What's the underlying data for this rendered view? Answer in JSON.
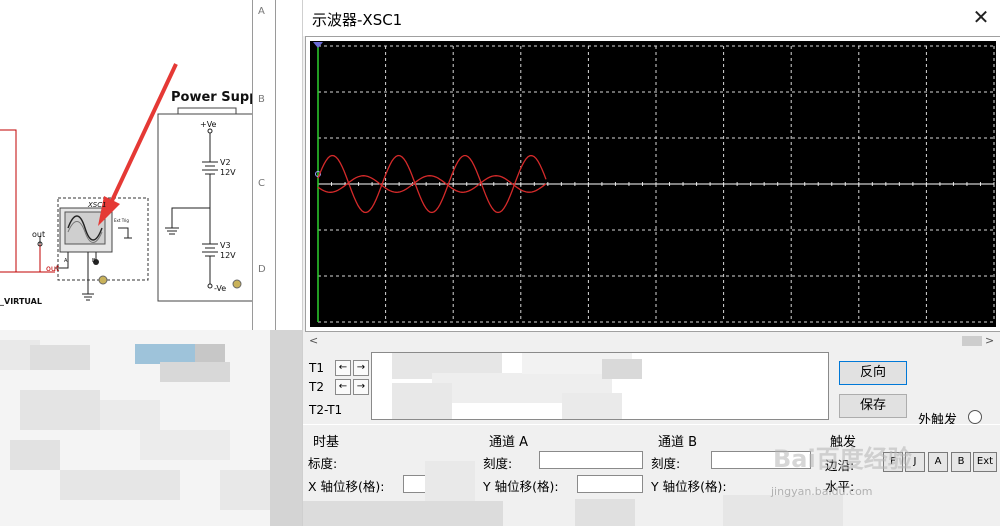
{
  "schematic": {
    "border_letters": [
      "A",
      "B",
      "C",
      "D"
    ],
    "power_supply_title": "Power Supply",
    "vpos_label": "+Ve",
    "vneg_label": "-Ve",
    "v2_name": "V2",
    "v2_value": "12V",
    "v3_name": "V3",
    "v3_value": "12V",
    "scope_ref": "XSC1",
    "scope_ext_trig": "Ext Trig",
    "scope_pin_a": "A",
    "scope_pin_b": "B",
    "out_label": "out",
    "out_label_red": "out",
    "virtual_label": "_VIRTUAL",
    "colors": {
      "wire_red": "#c00000",
      "wire_dark": "#222222",
      "arrow_red": "#e53935"
    }
  },
  "oscilloscope": {
    "title": "示波器-XSC1",
    "close_icon": "close-icon",
    "scrollbar_left": "<",
    "scrollbar_right": ">",
    "cursor_rows": [
      {
        "label": "T1",
        "left": "←",
        "right": "→"
      },
      {
        "label": "T2",
        "left": "←",
        "right": "→"
      },
      {
        "label": "T2-T1"
      }
    ],
    "buttons": {
      "reverse": "反向",
      "save": "保存"
    },
    "ext_trigger_label": "外触发",
    "timebase": {
      "title": "时基",
      "scale_label": "标度:",
      "xpos_label": "X 轴位移(格):"
    },
    "channel_a": {
      "title": "通道 A",
      "scale_label": "刻度:",
      "ypos_label": "Y 轴位移(格):"
    },
    "channel_b": {
      "title": "通道 B",
      "scale_label": "刻度:",
      "ypos_label": "Y 轴位移(格):"
    },
    "trigger": {
      "title": "触发",
      "edge_label": "边沿:",
      "level_label": "水平:",
      "edge_buttons": [
        "F",
        "J",
        "A",
        "B",
        "Ext"
      ]
    },
    "watermark_text": "Bai百度经验",
    "watermark_url": "jingyan.baidu.com",
    "colors": {
      "screen_bg": "#000000",
      "grid": "#d8d8d8",
      "trace": "#d42a2a",
      "cursor": "#2ed12e"
    }
  }
}
